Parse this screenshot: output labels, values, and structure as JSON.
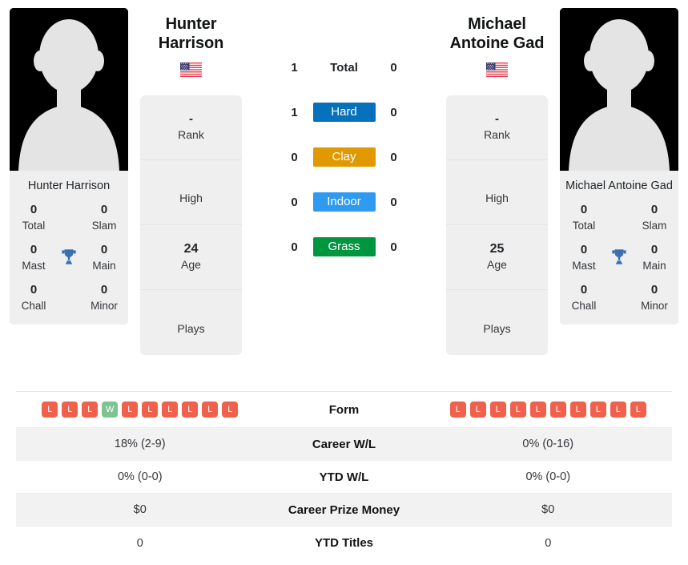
{
  "players": {
    "left": {
      "name": "Hunter Harrison",
      "name_line1": "Hunter",
      "name_line2": "Harrison",
      "avatar_caption": "Hunter Harrison",
      "country_flag": "usa-flag",
      "titles": {
        "total_value": "0",
        "total_label": "Total",
        "slam_value": "0",
        "slam_label": "Slam",
        "mast_value": "0",
        "mast_label": "Mast",
        "main_value": "0",
        "main_label": "Main",
        "chall_value": "0",
        "chall_label": "Chall",
        "minor_value": "0",
        "minor_label": "Minor"
      },
      "stats": [
        {
          "value": "-",
          "label": "Rank"
        },
        {
          "value": "",
          "label": "High"
        },
        {
          "value": "24",
          "label": "Age"
        },
        {
          "value": "",
          "label": "Plays"
        }
      ],
      "h2h": {
        "total": "1",
        "hard": "1",
        "clay": "0",
        "indoor": "0",
        "grass": "0"
      },
      "form": [
        "L",
        "L",
        "L",
        "W",
        "L",
        "L",
        "L",
        "L",
        "L",
        "L"
      ],
      "career_wl": "18% (2-9)",
      "ytd_wl": "0% (0-0)",
      "career_prize_money": "$0",
      "ytd_titles": "0"
    },
    "right": {
      "name": "Michael Antoine Gad",
      "name_line1": "Michael",
      "name_line2": "Antoine Gad",
      "avatar_caption": "Michael Antoine Gad",
      "country_flag": "usa-flag",
      "titles": {
        "total_value": "0",
        "total_label": "Total",
        "slam_value": "0",
        "slam_label": "Slam",
        "mast_value": "0",
        "mast_label": "Mast",
        "main_value": "0",
        "main_label": "Main",
        "chall_value": "0",
        "chall_label": "Chall",
        "minor_value": "0",
        "minor_label": "Minor"
      },
      "stats": [
        {
          "value": "-",
          "label": "Rank"
        },
        {
          "value": "",
          "label": "High"
        },
        {
          "value": "25",
          "label": "Age"
        },
        {
          "value": "",
          "label": "Plays"
        }
      ],
      "h2h": {
        "total": "0",
        "hard": "0",
        "clay": "0",
        "indoor": "0",
        "grass": "0"
      },
      "form": [
        "L",
        "L",
        "L",
        "L",
        "L",
        "L",
        "L",
        "L",
        "L",
        "L"
      ],
      "career_wl": "0% (0-16)",
      "ytd_wl": "0% (0-0)",
      "career_prize_money": "$0",
      "ytd_titles": "0"
    }
  },
  "surfaces": [
    {
      "key": "total",
      "label": "Total",
      "chip": false,
      "color": ""
    },
    {
      "key": "hard",
      "label": "Hard",
      "chip": true,
      "color": "#0571bd"
    },
    {
      "key": "clay",
      "label": "Clay",
      "chip": true,
      "color": "#e09900"
    },
    {
      "key": "indoor",
      "label": "Indoor",
      "chip": true,
      "color": "#2e9bf0"
    },
    {
      "key": "grass",
      "label": "Grass",
      "chip": true,
      "color": "#00963f"
    }
  ],
  "comparison_rows": [
    {
      "label": "Form"
    },
    {
      "label": "Career W/L"
    },
    {
      "label": "YTD W/L"
    },
    {
      "label": "Career Prize Money"
    },
    {
      "label": "YTD Titles"
    }
  ],
  "colors": {
    "win_badge": "#7ec490",
    "loss_badge": "#f0614d",
    "panel_bg": "#efefef",
    "row_alt_bg": "#f2f2f2",
    "trophy": "#3a6eb5",
    "hard": "#0571bd",
    "clay": "#e09900",
    "indoor": "#2e9bf0",
    "grass": "#00963f"
  }
}
